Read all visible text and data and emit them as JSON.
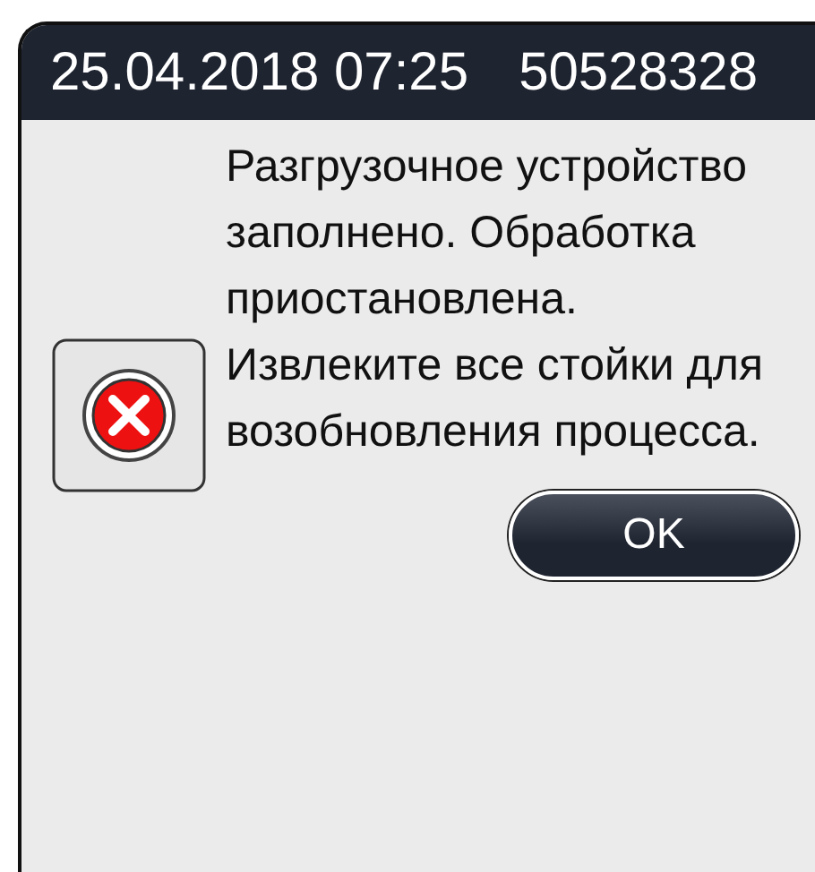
{
  "header": {
    "datetime": "25.04.2018 07:25",
    "serial": "50528328"
  },
  "dialog": {
    "message": "Разгрузочное устройство заполнено. Обработка приостановлена. Извлеките все стойки для возобновления процесса.",
    "buttons": [
      "OK"
    ]
  }
}
